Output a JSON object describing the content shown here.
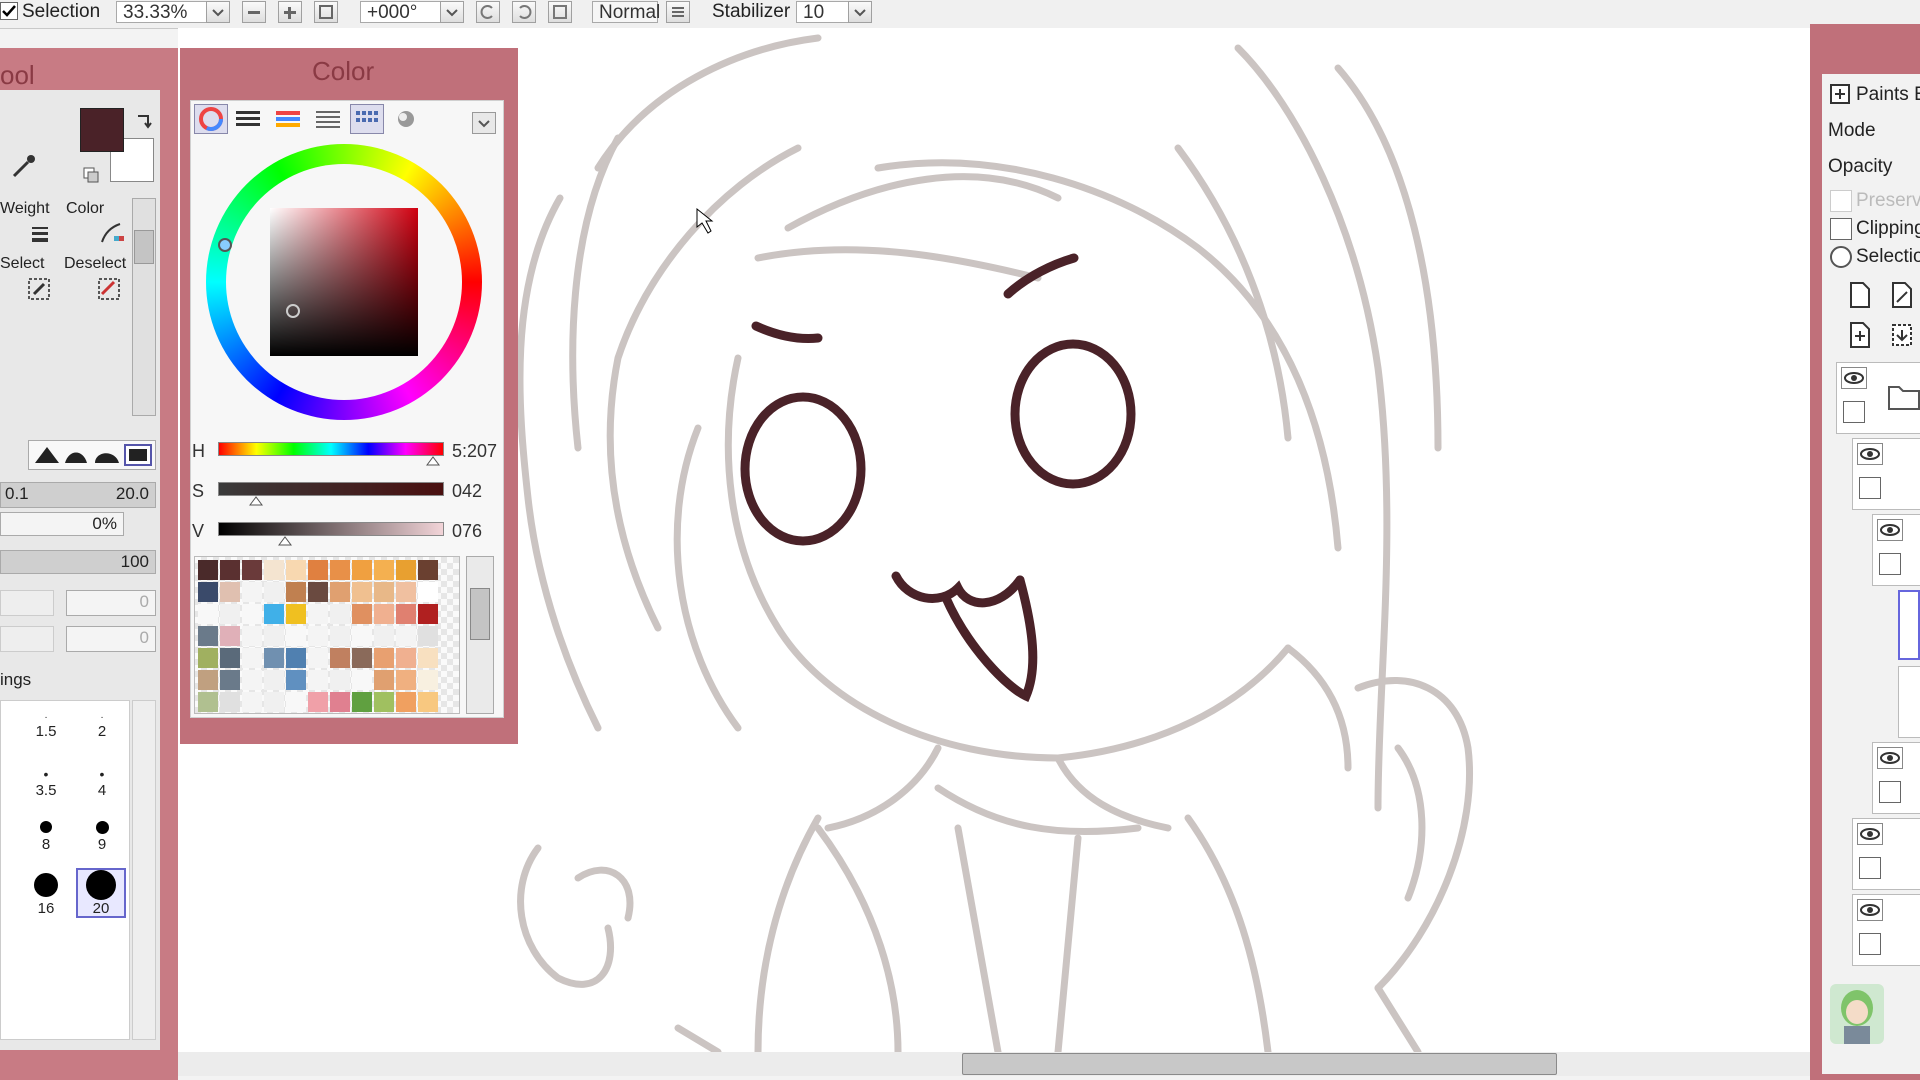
{
  "toolbar": {
    "selection_label": "Selection",
    "zoom": "33.33%",
    "rotation": "+000°",
    "blend_mode": "Normal",
    "stabilizer_label": "Stabilizer",
    "stabilizer_value": "10"
  },
  "tool_panel": {
    "title": "ool",
    "weight_label": "Weight",
    "color_label": "Color",
    "select_label": "Select",
    "deselect_label": "Deselect",
    "min_size": "0.1",
    "max_size": "20.0",
    "density": "0%",
    "density2": "100",
    "field_a": "0",
    "field_b": "0",
    "settings_label": "ings",
    "brush_sizes": [
      {
        "label": "1.5"
      },
      {
        "label": "2"
      },
      {
        "label": "3.5"
      },
      {
        "label": "4"
      },
      {
        "label": "8"
      },
      {
        "label": "9"
      },
      {
        "label": "16"
      },
      {
        "label": "20"
      }
    ]
  },
  "color_panel": {
    "title": "Color",
    "h_label": "H",
    "s_label": "S",
    "v_label": "V",
    "h_value": "5:207",
    "s_value": "042",
    "v_value": "076",
    "primary_color": "#4a2228",
    "secondary_color": "#ffffff",
    "swatches": [
      "#4a2a2a",
      "#5a3030",
      "#6a3a3a",
      "#f4e4d0",
      "#f8d8b0",
      "#e08040",
      "#e89048",
      "#f0a040",
      "#f4b050",
      "#e8a030",
      "#6a4030",
      "#3a4a6a",
      "#e0c0b0",
      "#f4f4f4",
      "#f0f0f0",
      "#c08050",
      "#6a4a40",
      "#e0a070",
      "#f0c090",
      "#e8b888",
      "#f0c0a0",
      "#ffffff",
      "#f8f8f8",
      "#f0f0f0",
      "#f8f8f8",
      "#40b0e8",
      "#f0c020",
      "#f4f4f4",
      "#f0f0f0",
      "#e09060",
      "#f0b090",
      "#e08070",
      "#b02020",
      "#6a7a8a",
      "#e0b0b8",
      "#f4f4f4",
      "#f0f0f0",
      "#f8f8f8",
      "#f4f4f4",
      "#f0f0f0",
      "#f8f8f8",
      "#f0f0f0",
      "#f4f4f4",
      "#e0e0e0",
      "#a0b060",
      "#5a6a7a",
      "#f4f4f4",
      "#7090b0",
      "#5080b0",
      "#f4f4f4",
      "#c08060",
      "#8a6a5a",
      "#e8a070",
      "#f0b090",
      "#f8e0c0",
      "#c0a080",
      "#6a7a8a",
      "#f4f4f4",
      "#f0f0f0",
      "#6090c0",
      "#f4f4f4",
      "#f0f0f0",
      "#f8f8f8",
      "#e0a070",
      "#f0b080",
      "#f8f0e0",
      "#b0c090",
      "#e0e0e0",
      "#f4f4f4",
      "#f0f0f0",
      "#f8f8f8",
      "#f0a0a8",
      "#e08090",
      "#60a040",
      "#a0c060",
      "#f0a060",
      "#f8c880"
    ]
  },
  "layer_panel": {
    "paints_label": "Paints E",
    "mode_label": "Mode",
    "opacity_label": "Opacity",
    "preserve_label": "Preserv",
    "clipping_label": "Clipping",
    "selection_label": "Selectio"
  },
  "colors": {
    "panel_pink": "#c0707a",
    "line_art": "#4a2228",
    "sketch": "#cbc4c2"
  }
}
